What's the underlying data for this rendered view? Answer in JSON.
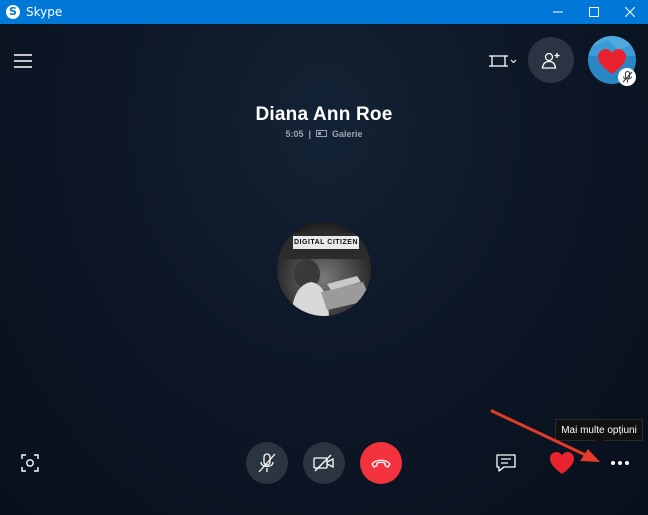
{
  "window": {
    "title": "Skype",
    "icon": "skype-logo-icon"
  },
  "contact": {
    "name": "Diana Ann Roe",
    "duration": "5:05",
    "separator": "|",
    "view_mode": "Galerie"
  },
  "avatar": {
    "banner_text": "DIGITAL CITIZEN"
  },
  "top_controls": {
    "menu": "hamburger-menu-icon",
    "screen_size": "screen-size-icon",
    "add_participant": "add-person-icon",
    "self_view_muted": "microphone-off-icon"
  },
  "bottom_controls": {
    "capture": "camera-capture-icon",
    "mic": "microphone-off-icon",
    "video": "video-off-icon",
    "end_call": "end-call-icon",
    "chat": "chat-icon",
    "react": "heart-icon",
    "more": "more-options-icon"
  },
  "tooltip": {
    "text": "Mai multe opțiuni"
  },
  "colors": {
    "titlebar": "#0078d7",
    "end_call": "#f2323c",
    "heart": "#e8222e",
    "arrow": "#e53a2a",
    "background": "#0c1a2b"
  }
}
